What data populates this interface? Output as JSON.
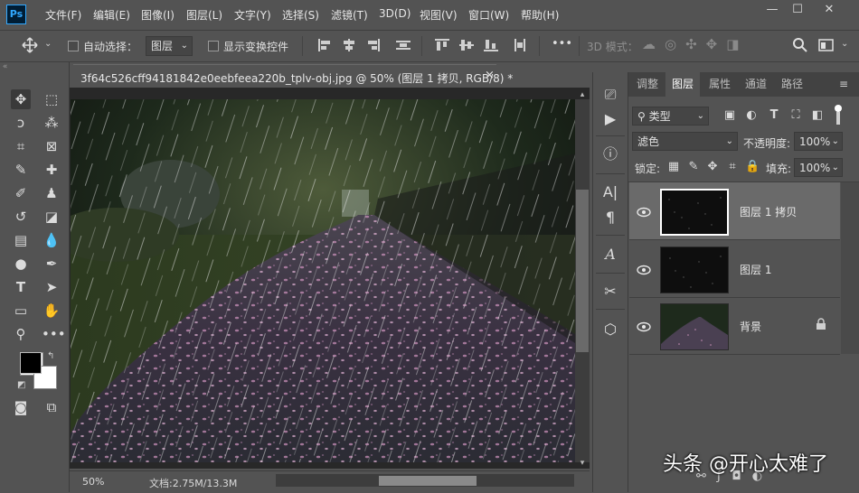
{
  "app": {
    "logo": "Ps"
  },
  "menu": [
    "文件(F)",
    "编辑(E)",
    "图像(I)",
    "图层(L)",
    "文字(Y)",
    "选择(S)",
    "滤镜(T)",
    "3D(D)",
    "视图(V)",
    "窗口(W)",
    "帮助(H)"
  ],
  "window_controls": {
    "minimize": "—",
    "maximize": "☐",
    "close": "✕"
  },
  "options": {
    "auto_select_label": "自动选择：",
    "auto_select_value": "图层",
    "show_transform_label": "显示变换控件",
    "mode_3d_label": "3D 模式：",
    "more": "•••"
  },
  "document": {
    "tab_title": "3f64c526cff94181842e0eebfeea220b_tplv-obj.jpg @ 50% (图层 1 拷贝, RGB/8) *",
    "close": "×",
    "zoom": "50%",
    "doc_size": "文档:2.75M/13.3M"
  },
  "panel_tabs": [
    "调整",
    "图层",
    "属性",
    "通道",
    "路径"
  ],
  "layers_panel": {
    "filter_type": "类型",
    "blend_mode": "滤色",
    "opacity_label": "不透明度:",
    "opacity_value": "100%",
    "lock_label": "锁定:",
    "fill_label": "填充:",
    "fill_value": "100%",
    "layers": [
      {
        "name": "图层 1 拷贝",
        "selected": true
      },
      {
        "name": "图层 1",
        "selected": false
      },
      {
        "name": "背景",
        "selected": false,
        "locked": true
      }
    ]
  },
  "watermark": "头条 @开心太难了",
  "colors": {
    "ui_bg": "#535353",
    "panel_dark": "#424242",
    "selected_row": "#6a6a6a",
    "foreground": "#000000",
    "background": "#ffffff"
  }
}
